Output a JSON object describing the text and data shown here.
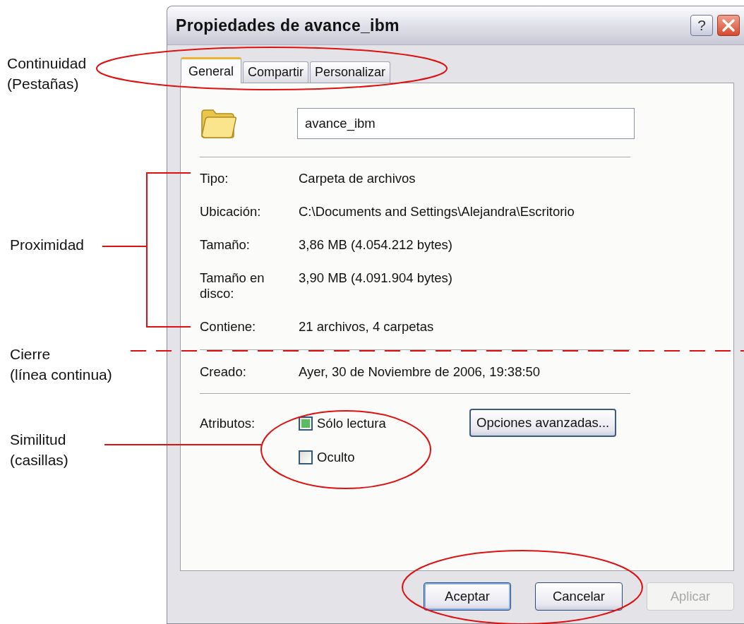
{
  "window": {
    "title": "Propiedades de avance_ibm",
    "help_button": "?"
  },
  "tabs": [
    {
      "label": "General",
      "selected": true
    },
    {
      "label": "Compartir",
      "selected": false
    },
    {
      "label": "Personalizar",
      "selected": false
    }
  ],
  "name_field": {
    "value": "avance_ibm"
  },
  "details": [
    {
      "label": "Tipo:",
      "value": "Carpeta de archivos"
    },
    {
      "label": "Ubicación:",
      "value": "C:\\Documents and Settings\\Alejandra\\Escritorio"
    },
    {
      "label": "Tamaño:",
      "value": "3,86 MB (4.054.212 bytes)"
    },
    {
      "label": "Tamaño en disco:",
      "value": "3,90 MB (4.091.904 bytes)"
    },
    {
      "label": "Contiene:",
      "value": "21 archivos, 4 carpetas"
    }
  ],
  "dates": [
    {
      "label": "Creado:",
      "value": "Ayer, 30 de Noviembre de 2006, 19:38:50"
    }
  ],
  "attributes": {
    "label": "Atributos:",
    "advanced_button": "Opciones avanzadas...",
    "options": [
      {
        "label": "Sólo lectura",
        "checked": true
      },
      {
        "label": "Oculto",
        "checked": false
      }
    ]
  },
  "buttons": [
    {
      "label": "Aceptar",
      "disabled": false
    },
    {
      "label": "Cancelar",
      "disabled": false
    },
    {
      "label": "Aplicar",
      "disabled": true
    }
  ],
  "annotations": [
    {
      "kind": "ellipse",
      "lines": [
        "Continuidad",
        "(Pestañas)"
      ]
    },
    {
      "kind": "bracket",
      "lines": [
        "Proximidad"
      ]
    },
    {
      "kind": "dashed-line",
      "lines": [
        "Cierre",
        "(línea continua)"
      ]
    },
    {
      "kind": "ellipse",
      "lines": [
        "Similitud",
        "(casillas)"
      ]
    },
    {
      "kind": "ellipse"
    }
  ]
}
